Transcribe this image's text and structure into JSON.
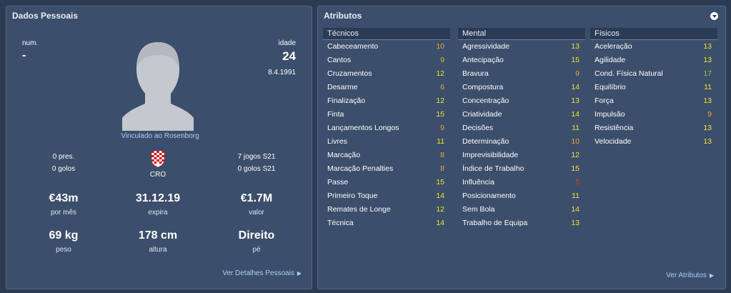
{
  "left": {
    "title": "Dados Pessoais",
    "num_label": "num.",
    "num_value": "-",
    "age_label": "idade",
    "age_value": "24",
    "birthdate": "8.4.1991",
    "contract_link": "Vinculado ao Rosenborg",
    "apps": "0 pres.",
    "goals": "0 golos",
    "nation": "CRO",
    "u21_apps": "7 jogos S21",
    "u21_goals": "0 golos S21",
    "value_label_1": "€43m",
    "sub_1": "por mês",
    "value_label_2": "31.12.19",
    "sub_2": "expira",
    "value_label_3": "€1.7M",
    "sub_3": "valor",
    "weight": "69 kg",
    "weight_label": "peso",
    "height": "178 cm",
    "height_label": "altura",
    "foot": "Direito",
    "foot_label": "pé",
    "details_link": "Ver Detalhes Pessoais"
  },
  "right": {
    "title": "Atributos",
    "link": "Ver Atributos",
    "columns": [
      {
        "header": "Técnicos",
        "rows": [
          {
            "label": "Cabeceamento",
            "value": "10",
            "color": "#f2a531"
          },
          {
            "label": "Cantos",
            "value": "9",
            "color": "#f2a531"
          },
          {
            "label": "Cruzamentos",
            "value": "12",
            "color": "#f2e531"
          },
          {
            "label": "Desarme",
            "value": "6",
            "color": "#f2a531"
          },
          {
            "label": "Finalização",
            "value": "12",
            "color": "#f2e531"
          },
          {
            "label": "Finta",
            "value": "15",
            "color": "#f2e531"
          },
          {
            "label": "Lançamentos Longos",
            "value": "9",
            "color": "#f2a531"
          },
          {
            "label": "Livres",
            "value": "11",
            "color": "#f2e531"
          },
          {
            "label": "Marcação",
            "value": "8",
            "color": "#f2a531"
          },
          {
            "label": "Marcação Penalties",
            "value": "8",
            "color": "#f2a531"
          },
          {
            "label": "Passe",
            "value": "15",
            "color": "#f2e531"
          },
          {
            "label": "Primeiro Toque",
            "value": "14",
            "color": "#f2e531"
          },
          {
            "label": "Remates de Longe",
            "value": "12",
            "color": "#f2e531"
          },
          {
            "label": "Técnica",
            "value": "14",
            "color": "#f2e531"
          }
        ]
      },
      {
        "header": "Mental",
        "rows": [
          {
            "label": "Agressividade",
            "value": "13",
            "color": "#f2e531"
          },
          {
            "label": "Antecipação",
            "value": "15",
            "color": "#f2e531"
          },
          {
            "label": "Bravura",
            "value": "9",
            "color": "#f2a531"
          },
          {
            "label": "Compostura",
            "value": "14",
            "color": "#f2e531"
          },
          {
            "label": "Concentração",
            "value": "13",
            "color": "#f2e531"
          },
          {
            "label": "Criatividade",
            "value": "14",
            "color": "#f2e531"
          },
          {
            "label": "Decisões",
            "value": "11",
            "color": "#f2e531"
          },
          {
            "label": "Determinação",
            "value": "10",
            "color": "#f2a531"
          },
          {
            "label": "Imprevisibilidade",
            "value": "12",
            "color": "#f2e531"
          },
          {
            "label": "Índice de Trabalho",
            "value": "15",
            "color": "#f2e531"
          },
          {
            "label": "Influência",
            "value": "5",
            "color": "#e03a2a"
          },
          {
            "label": "Posicionamento",
            "value": "11",
            "color": "#f2e531"
          },
          {
            "label": "Sem Bola",
            "value": "14",
            "color": "#f2e531"
          },
          {
            "label": "Trabalho de Equipa",
            "value": "13",
            "color": "#f2e531"
          }
        ]
      },
      {
        "header": "Físicos",
        "rows": [
          {
            "label": "Aceleração",
            "value": "13",
            "color": "#f2e531"
          },
          {
            "label": "Agilidade",
            "value": "13",
            "color": "#f2e531"
          },
          {
            "label": "Cond. Física Natural",
            "value": "17",
            "color": "#7ed23a"
          },
          {
            "label": "Equilíbrio",
            "value": "11",
            "color": "#f2e531"
          },
          {
            "label": "Força",
            "value": "13",
            "color": "#f2e531"
          },
          {
            "label": "Impulsão",
            "value": "9",
            "color": "#f2a531"
          },
          {
            "label": "Resistência",
            "value": "13",
            "color": "#f2e531"
          },
          {
            "label": "Velocidade",
            "value": "13",
            "color": "#f2e531"
          }
        ]
      }
    ]
  }
}
